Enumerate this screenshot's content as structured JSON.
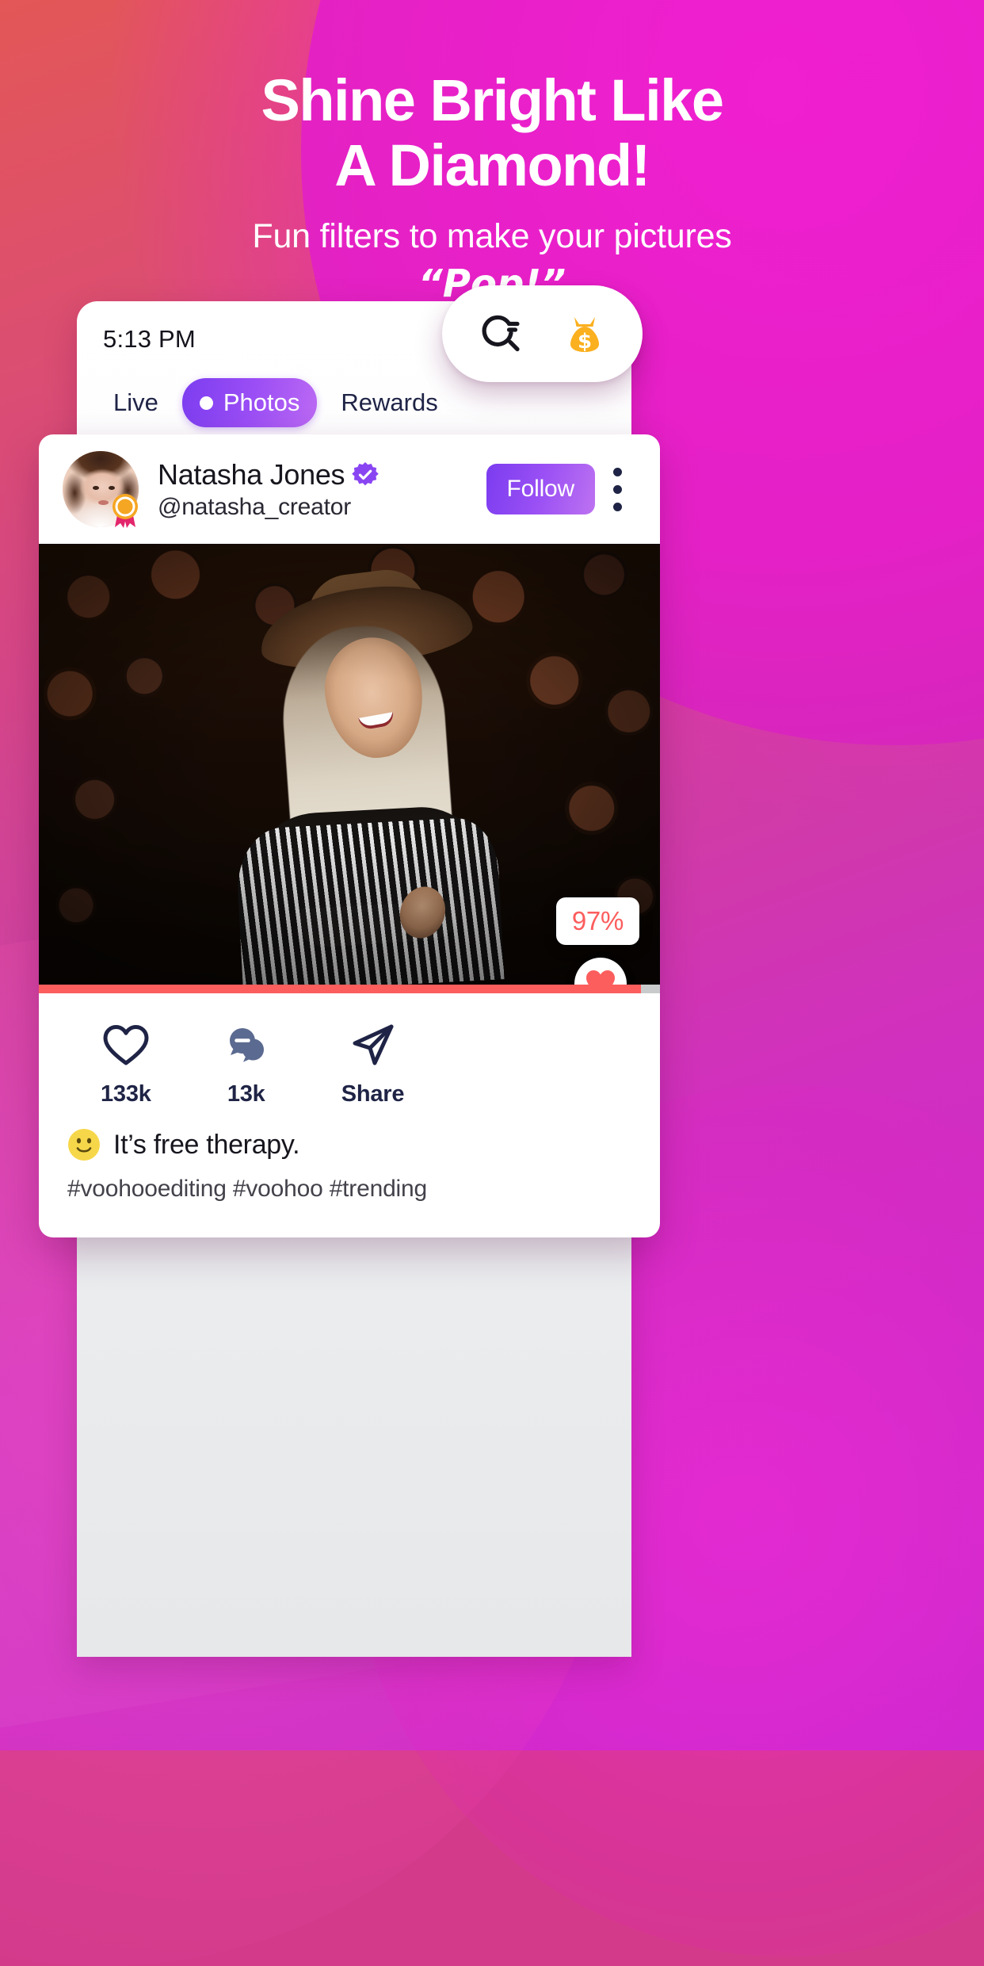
{
  "hero": {
    "headline_line1": "Shine Bright Like",
    "headline_line2": "A Diamond!",
    "subline": "Fun filters to make your pictures",
    "popline": "“Pop!”"
  },
  "phone": {
    "status_time": "5:13 PM",
    "tabs": [
      {
        "label": "Live",
        "active": false
      },
      {
        "label": "Photos",
        "active": true
      },
      {
        "label": "Rewards",
        "active": false
      }
    ]
  },
  "float_pill": {
    "search_icon": "search-icon",
    "money_icon": "money-bag-icon"
  },
  "post": {
    "display_name": "Natasha Jones",
    "verified_icon": "verified-badge-icon",
    "handle": "@natasha_creator",
    "follow_label": "Follow",
    "more_icon": "more-vertical-icon",
    "avatar_icon": "avatar",
    "medal_icon": "medal-icon",
    "score": "97%",
    "score_heart_icon": "heart-filled-icon",
    "progress_percent": 97,
    "actions": [
      {
        "icon": "heart-outline-icon",
        "count": "133k"
      },
      {
        "icon": "comment-icon",
        "count": "13k"
      },
      {
        "icon": "share-icon",
        "count": "Share"
      }
    ],
    "caption_emoji": "slightly-smiling-face-emoji",
    "caption": "It’s free therapy.",
    "hashtags": "#voohooediting #voohoo #trending"
  },
  "colors": {
    "accent_purple": "#8a45f2",
    "accent_coral": "#fc5d5d",
    "money_orange": "#fbb01f",
    "navy": "#1f2446"
  }
}
